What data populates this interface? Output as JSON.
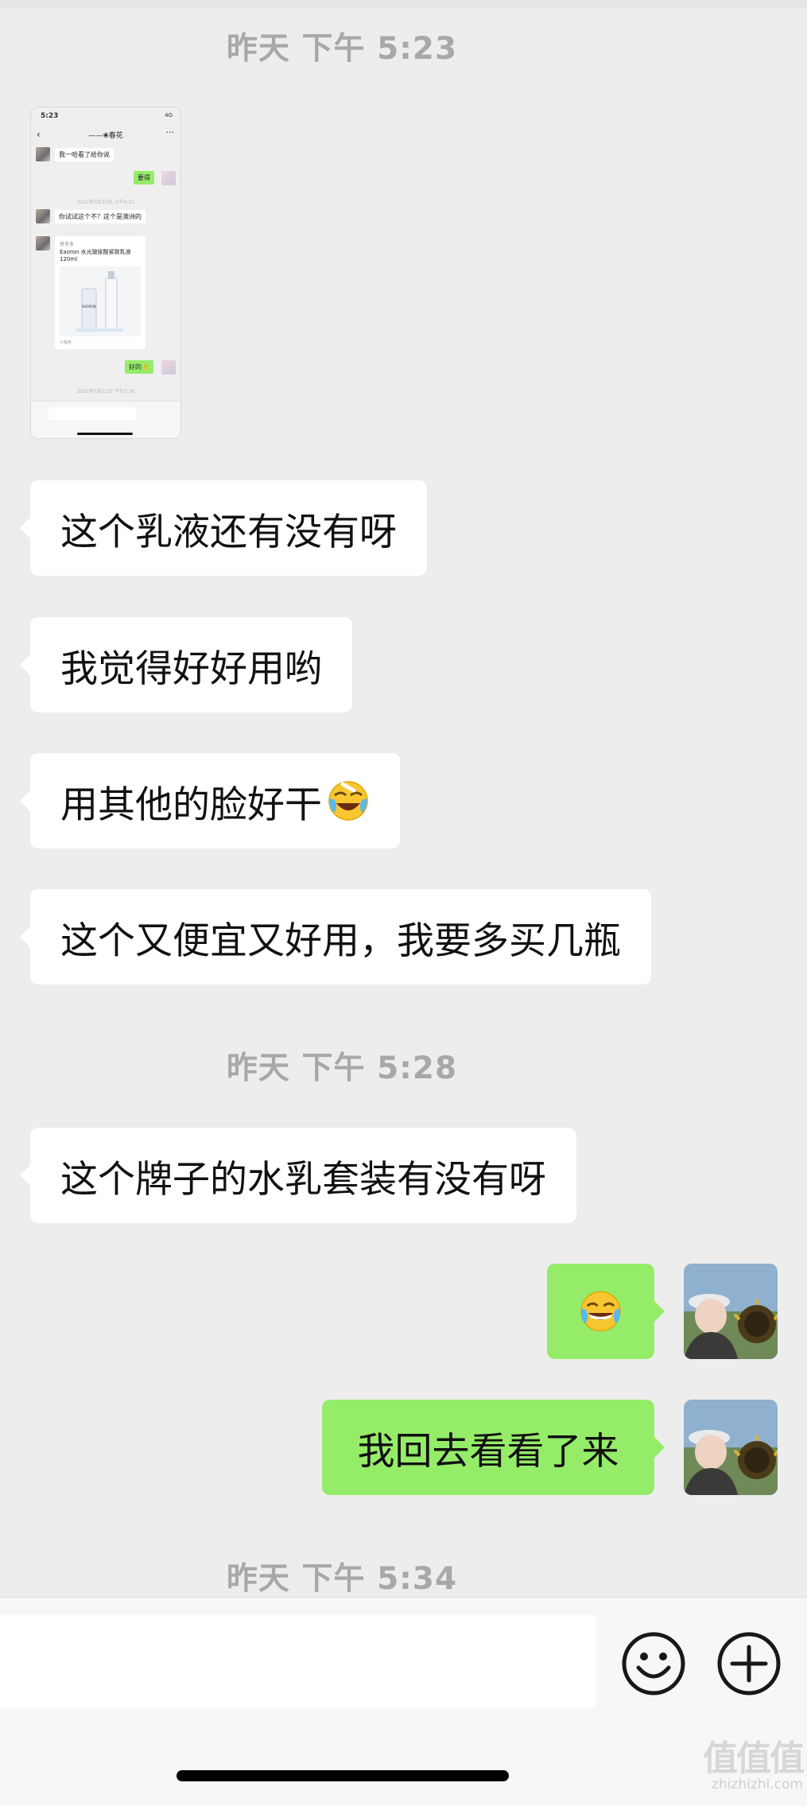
{
  "timestamps": [
    {
      "day": "昨天",
      "time": "下午 5:23"
    },
    {
      "day": "昨天",
      "time": "下午 5:28"
    },
    {
      "day": "昨天",
      "time": "下午 5:34"
    }
  ],
  "thumbnail": {
    "status_time": "5:23",
    "status_right": "4G",
    "contact_name": "——❀春花",
    "messages": [
      {
        "side": "in",
        "text": "我一哈看了给你说"
      },
      {
        "side": "out",
        "text": "要得"
      },
      {
        "side": "time",
        "text": "2021年6月10日 上午4:21"
      },
      {
        "side": "in",
        "text": "你试试这个不？这个是澳洲的"
      },
      {
        "side": "out",
        "text": "好的👌"
      },
      {
        "side": "time",
        "text": "2021年6月11日 下午2:30"
      }
    ],
    "card": {
      "source": "拼多多",
      "title": "Eaoron 水光玻尿酸紧致乳液 120ml",
      "brand_on_bottle": "EAORON",
      "footer": "小程序"
    }
  },
  "messages": [
    {
      "side": "in",
      "text": "这个乳液还有没有呀"
    },
    {
      "side": "in",
      "text": "我觉得好好用哟"
    },
    {
      "side": "in",
      "text": "用其他的脸好干",
      "emoji": "crying-laughing-emoji"
    },
    {
      "side": "in",
      "text": "这个又便宜又好用，我要多买几瓶"
    },
    {
      "side": "in",
      "text": "这个牌子的水乳套装有没有呀"
    },
    {
      "side": "out",
      "text": "",
      "emoji": "tears-of-joy-emoji"
    },
    {
      "side": "out",
      "text": "我回去看看了来"
    }
  ],
  "input_bar": {
    "placeholder": "",
    "emoji_icon": "emoji-icon",
    "plus_icon": "plus-icon"
  },
  "watermark": {
    "main": "值值值",
    "sub": "zhizhizhi.com"
  },
  "colors": {
    "background": "#ededed",
    "incoming_bubble": "#ffffff",
    "outgoing_bubble": "#95ec69",
    "timestamp": "#a8a8a8"
  }
}
